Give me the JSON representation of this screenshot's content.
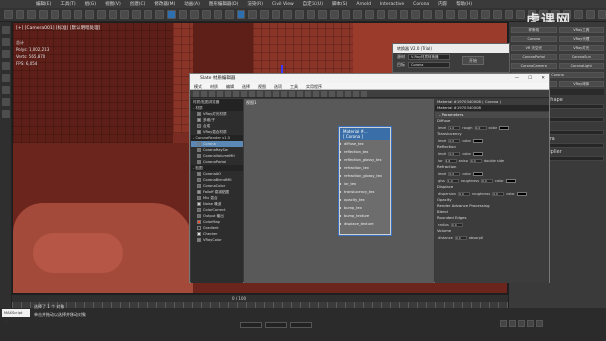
{
  "menubar": {
    "items": [
      "编辑(E)",
      "工具(T)",
      "组(G)",
      "视图(V)",
      "创建(C)",
      "修改器(M)",
      "动画(A)",
      "图形编辑器(D)",
      "渲染(R)",
      "Civil View",
      "自定义(U)",
      "脚本(S)",
      "Arnold",
      "Interactive",
      "Corona",
      "内容",
      "帮助(H)"
    ]
  },
  "watermark": "虎课网",
  "viewport": {
    "label": "[+] [Camera001] [标准] [默认明暗处理]",
    "stats": [
      "总计",
      "Polys: 1,002,213",
      "Verts:   565,870",
      "FPS:    6,054"
    ]
  },
  "small_dialog": {
    "title": "转换器 V2.0 (Trial)",
    "rows": [
      {
        "label": "源材",
        "value": "V-Ray材质转换器"
      },
      {
        "label": "目标",
        "value": "Corona"
      }
    ],
    "button": "开始"
  },
  "slate": {
    "title": "Slate 材质编辑器",
    "menu": [
      "模式",
      "材质",
      "编辑",
      "选择",
      "视图",
      "选项",
      "工具",
      "实用程序"
    ],
    "view_tab": "视图1",
    "browser": {
      "header": "材质/贴图浏览器",
      "sections": [
        {
          "title": "- 材质",
          "items": [
            "VRay灯光材质",
            "多维/子",
            "合成",
            "VRay混合材质"
          ],
          "colors": [
            "#808080",
            "#a0a0a0",
            "#606060",
            "#909090"
          ]
        },
        {
          "title": "- CoronaRender v1.5",
          "items": [
            "Corona",
            "CoronaRaySw",
            "CoronaVolumeMtl",
            "CoronaPortal"
          ],
          "colors": [
            "#5b88b5",
            "#707070",
            "#707070",
            "#707070"
          ],
          "selected": 0
        },
        {
          "title": "- 贴图",
          "items": [
            "CoronaAO",
            "CoronaBlendMtl",
            "CoronaColor",
            "Falloff 衰减贴图",
            "Mix 混合",
            "Noise 噪波",
            "ColorCorrect",
            "Output 输出",
            "ColorMap",
            "Gradient",
            "Checker",
            "VRayColor"
          ],
          "colors": [
            "#808080",
            "#6a6a6a",
            "#6a6a6a",
            "#9a9a9a",
            "#6a6a6a",
            "#d0d0d0",
            "#6a6a6a",
            "#6a6a6a",
            "#ff4a2a",
            "#303030",
            "#e0e0e0",
            "#808080"
          ]
        }
      ],
      "status": "正在渲染完成"
    },
    "node": {
      "title": "Material #...",
      "subtitle": "[ Corona ]",
      "slots": [
        "diffuse_tex",
        "reflection_tex",
        "reflection_glossy_tex",
        "refraction_tex",
        "refraction_glossy_tex",
        "ior_tex",
        "translucency_tex",
        "opacity_tex",
        "bump_tex",
        "bump_texture",
        "displace_texture"
      ]
    },
    "params": {
      "header1": "Material #1970340008 ( Corona )",
      "header2": "Material #1970340008",
      "sections": [
        {
          "title": "Parameters",
          "rows": [
            [
              "Diffuse"
            ],
            [
              "level",
              "1.0",
              "rough",
              "0.0",
              "color"
            ],
            [
              "Translucency"
            ],
            [
              "level",
              "0.0",
              "color"
            ],
            [
              "Reflection"
            ],
            [
              "level",
              "0.0",
              "color"
            ],
            [
              "ior",
              "1.6",
              "aniso",
              "0.0",
              "double side"
            ],
            [
              "Refraction"
            ],
            [
              "level",
              "0.0",
              "color"
            ],
            [
              "glss",
              "1.0",
              "roughness",
              "0.0",
              "color"
            ],
            [
              "Displace"
            ],
            [
              "dispersion",
              "0.0",
              "roughness",
              "0.0",
              "color"
            ],
            [
              "Opacity"
            ],
            [
              "Render Advance Processing"
            ],
            [
              "Blend"
            ],
            [
              "Rounded Edges"
            ],
            [
              "radius",
              "0.0"
            ],
            [
              "Volume"
            ],
            [
              "distance",
              "0.0",
              "absorpti"
            ]
          ]
        }
      ]
    }
  },
  "command_panel": {
    "buttons": [
      [
        "样条线",
        "VRay工具"
      ],
      [
        "Corona",
        "VRay代理"
      ],
      [
        "VR 天空光",
        "VRay灯光"
      ],
      [
        "CoronaPortal",
        "CoronaSun"
      ],
      [
        "CoronaCamera",
        "CoronaLight"
      ],
      [
        "Corona"
      ],
      [
        "VRay物理相机",
        "VRay球体"
      ]
    ],
    "section": "- 参数",
    "labels": [
      "Show Preview Shape",
      "Light Direction",
      "Cast Shadows",
      "Visible in Camera",
      "Use Visual Multiplier"
    ]
  },
  "timeline": {
    "frame": "0 / 100",
    "status1": "选择了 1 个 对象",
    "status2": "单击并拖动以选择并移动对象"
  },
  "search_label": "MAXScript 迷..."
}
